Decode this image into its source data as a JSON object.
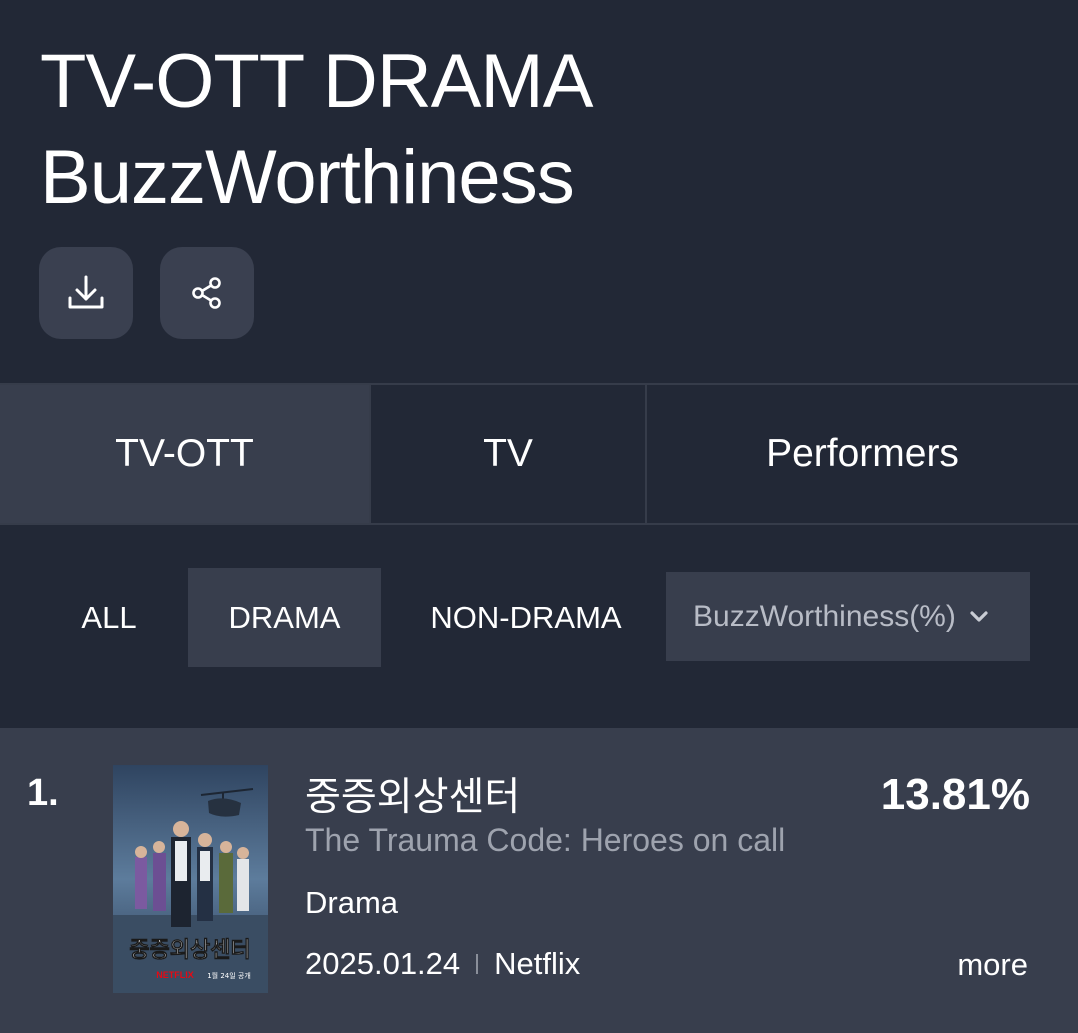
{
  "header": {
    "title_line1": "TV-OTT DRAMA",
    "title_line2": "BuzzWorthiness"
  },
  "actions": {
    "download_icon": "download-icon",
    "share_icon": "share-icon"
  },
  "tabs": [
    {
      "label": "TV-OTT",
      "selected": true
    },
    {
      "label": "TV",
      "selected": false
    },
    {
      "label": "Performers",
      "selected": false
    }
  ],
  "filters": [
    {
      "label": "ALL",
      "selected": false
    },
    {
      "label": "DRAMA",
      "selected": true
    },
    {
      "label": "NON-DRAMA",
      "selected": false
    }
  ],
  "metric_select": {
    "value": "BuzzWorthiness(%)"
  },
  "ranking": [
    {
      "rank": "1.",
      "korean_title": "중증외상센터",
      "english_title": "The Trauma Code: Heroes on call",
      "genre": "Drama",
      "date": "2025.01.24",
      "platform": "Netflix",
      "score": "13.81%",
      "more_label": "more",
      "poster": {
        "title_text": "중증외상센터",
        "brand": "NETFLIX",
        "date_text": "1월 24일 공개"
      }
    }
  ],
  "colors": {
    "background": "#222836",
    "panel": "#383e4d",
    "button": "#3a4050",
    "muted_text": "#9ea3ae",
    "netflix_red": "#e50914"
  }
}
